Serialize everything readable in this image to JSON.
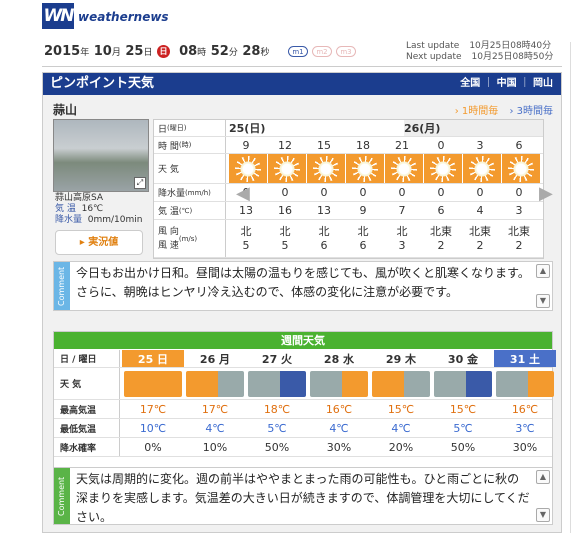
{
  "brand": {
    "logo": "WN",
    "name": "weathernews"
  },
  "clock": {
    "year": "2015",
    "month": "10",
    "day": "25",
    "weekday": "日",
    "hour": "08",
    "minute": "52",
    "second": "28"
  },
  "clock_units": {
    "year": "年",
    "month": "月",
    "day": "日",
    "hour": "時",
    "minute": "分",
    "second": "秒"
  },
  "pills": [
    "m1",
    "m2",
    "m3"
  ],
  "updates": {
    "last_label": "Last update",
    "last_value": "10月25日08時40分",
    "next_label": "Next update",
    "next_value": "10月25日08時50分"
  },
  "panel": {
    "title": "ピンポイント天気",
    "crumbs": [
      "全国",
      "中国",
      "岡山"
    ],
    "place": "蒜山",
    "tab_1h": "1時間毎",
    "tab_3h": "3時間毎"
  },
  "site": {
    "name": "蒜山高原SA",
    "temp_label": "気 温",
    "temp": "16℃",
    "rain_label": "降水量",
    "rain": "0mm/10min",
    "live_label": "実況値"
  },
  "hourly": {
    "labels": {
      "day": "日",
      "day_sub": "(曜日)",
      "time": "時 間",
      "time_sub": "(時)",
      "weather": "天 気",
      "rain": "降水量",
      "rain_sub": "(mm/h)",
      "temp": "気 温",
      "temp_sub": "(℃)",
      "wind": "風 向\n風 速",
      "wind_sub": "(m/s)"
    },
    "days": [
      "25(日)",
      "26(月)"
    ],
    "times": [
      "9",
      "12",
      "15",
      "18",
      "21",
      "0",
      "3",
      "6"
    ],
    "weather_icons": [
      "sun-icon",
      "sun-icon",
      "sun-icon",
      "sun-icon",
      "sun-icon",
      "sun-icon",
      "sun-icon",
      "sun-icon"
    ],
    "rain": [
      "0",
      "0",
      "0",
      "0",
      "0",
      "0",
      "0",
      "0"
    ],
    "temp": [
      "13",
      "16",
      "13",
      "9",
      "7",
      "6",
      "4",
      "3"
    ],
    "wind_dir": [
      "北",
      "北",
      "北",
      "北",
      "北",
      "北東",
      "北東",
      "北東"
    ],
    "wind_speed": [
      "5",
      "5",
      "6",
      "6",
      "3",
      "2",
      "2",
      "2"
    ]
  },
  "comment1": {
    "tag": "Comment",
    "text": "今日もお出かけ日和。昼間は太陽の温もりを感じても、風が吹くと肌寒くなります。さらに、朝晩はヒンヤリ冷え込むので、体感の変化に注意が必要です。"
  },
  "weekly": {
    "title": "週間天気",
    "labels": {
      "day": "日 / 曜日",
      "weather": "天 気",
      "max": "最高気温",
      "min": "最低気温",
      "pop": "降水確率"
    },
    "days": [
      "25 日",
      "26 月",
      "27 火",
      "28 水",
      "29 木",
      "30 金",
      "31 土"
    ],
    "weather_icons": [
      "sun-icon",
      "sun-cloud-icon",
      "cloud-rain-icon",
      "cloud-sun-icon",
      "sun-cloud-icon",
      "cloud-rain-icon",
      "cloud-sun-icon"
    ],
    "max": [
      "17℃",
      "17℃",
      "18℃",
      "16℃",
      "15℃",
      "15℃",
      "16℃"
    ],
    "min": [
      "10℃",
      "4℃",
      "5℃",
      "4℃",
      "4℃",
      "5℃",
      "3℃"
    ],
    "pop": [
      "0%",
      "10%",
      "50%",
      "30%",
      "20%",
      "50%",
      "30%"
    ],
    "colors": {
      "sunday": "#f39a2e",
      "saturday": "#4a70c8",
      "max": "#e07010",
      "min": "#3a6ad0"
    }
  },
  "comment2": {
    "tag": "Comment",
    "text": "天気は周期的に変化。週の前半はややまとまった雨の可能性も。ひと雨ごとに秋の深まりを実感します。気温差の大きい日が続きますので、体調管理を大切にしてください。"
  }
}
